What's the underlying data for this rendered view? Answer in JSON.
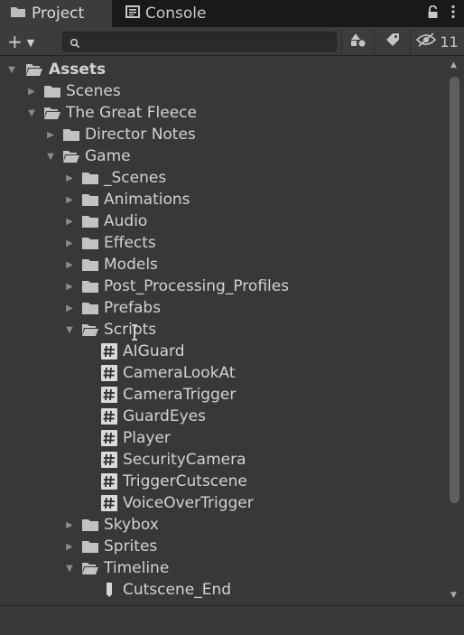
{
  "tabs": {
    "project_label": "Project",
    "console_label": "Console"
  },
  "toolbar": {
    "add_label": "+",
    "search_value": "",
    "hidden_count": "11"
  },
  "tree": {
    "assets": "Assets",
    "scenes": "Scenes",
    "great_fleece": "The Great Fleece",
    "director_notes": "Director Notes",
    "game": "Game",
    "game_scenes": "_Scenes",
    "animations": "Animations",
    "audio": "Audio",
    "effects": "Effects",
    "models": "Models",
    "post_processing": "Post_Processing_Profiles",
    "prefabs": "Prefabs",
    "scripts": "Scripts",
    "script_aiguard": "AIGuard",
    "script_cameralookat": "CameraLookAt",
    "script_cameratrigger": "CameraTrigger",
    "script_guardeyes": "GuardEyes",
    "script_player": "Player",
    "script_securitycamera": "SecurityCamera",
    "script_triggercutscene": "TriggerCutscene",
    "script_voiceovertrigger": "VoiceOverTrigger",
    "skybox": "Skybox",
    "sprites": "Sprites",
    "timeline": "Timeline",
    "cutscene_end": "Cutscene_End"
  },
  "colors": {
    "background": "#383838",
    "tabbar": "#191919",
    "active_tab": "#3c3c3c",
    "text": "#d2d2d2",
    "folder_icon": "#c2c2c2"
  }
}
